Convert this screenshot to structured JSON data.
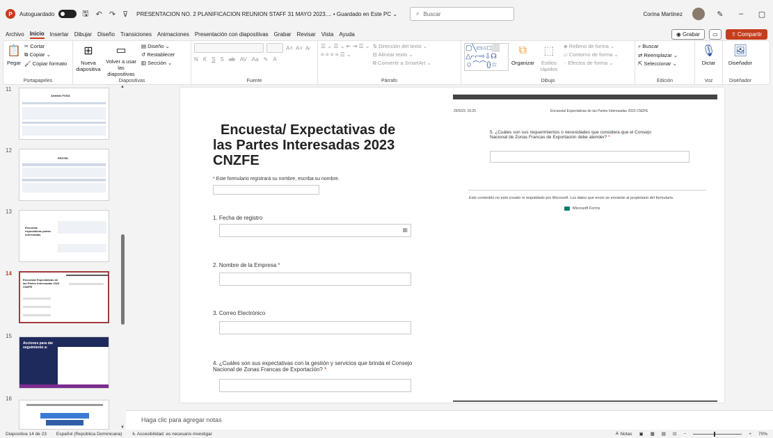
{
  "titlebar": {
    "autosave_label": "Autoguardado",
    "doc_title": "PRESENTACION NO. 2 PLANIFICACION REUNION STAFF 31 MAYO 2023....  •  Guardado en Este PC ⌄",
    "search_placeholder": "Buscar",
    "user_name": "Corina Martinez"
  },
  "menu": {
    "tabs": [
      "Archivo",
      "Inicio",
      "Insertar",
      "Dibujar",
      "Diseño",
      "Transiciones",
      "Animaciones",
      "Presentación con diapositivas",
      "Grabar",
      "Revisar",
      "Vista",
      "Ayuda"
    ],
    "grabar": "Grabar",
    "compartir": "Compartir"
  },
  "ribbon": {
    "portapapeles": {
      "pegar": "Pegar",
      "cortar": "Cortar",
      "copiar": "Copiar",
      "copiar_formato": "Copiar formato",
      "label": "Portapapeles"
    },
    "diapositivas": {
      "nueva": "Nueva diapositiva",
      "volver": "Volver a usar las diapositivas",
      "diseno": "Diseño",
      "restablecer": "Restablecer",
      "seccion": "Sección",
      "label": "Diapositivas"
    },
    "fuente": {
      "label": "Fuente"
    },
    "parrafo": {
      "direccion": "Dirección del texto",
      "alinear": "Alinear texto",
      "convertir": "Convertir a SmartArt",
      "label": "Párrafo"
    },
    "dibujo": {
      "organizar": "Organizar",
      "estilos": "Estilos rápidos",
      "relleno": "Relleno de forma",
      "contorno": "Contorno de forma",
      "efectos": "Efectos de forma",
      "label": "Dibujo"
    },
    "edicion": {
      "buscar": "Buscar",
      "reemplazar": "Reemplazar",
      "seleccionar": "Seleccionar",
      "label": "Edición"
    },
    "voz": {
      "dictar": "Dictar",
      "label": "Voz"
    },
    "disenador": {
      "btn": "Diseñador",
      "label": "Diseñador"
    }
  },
  "thumbnails": {
    "numbers": [
      "11",
      "12",
      "13",
      "14",
      "15",
      "16"
    ],
    "t11_title": "Análisis FODA",
    "t12_title": "PESTEL",
    "t13_title": "Encuesta expectativas partes interesadas",
    "t14_title": "Encuesta/ Expectativas de las Partes Interesadas 2023 CNZFE",
    "t15_title": "Acciones para dar seguimiento a:"
  },
  "slide": {
    "title_line1": "Encuesta/ Expectativas de",
    "title_line2": "las Partes Interesadas 2023",
    "title_line3": "CNZFE",
    "intro": "Este formulario registrará su nombre, escriba su nombre.",
    "q1": "1. Fecha de registro",
    "q2": "2. Nombre de la Empresa",
    "q3": "3. Correo Electrónico",
    "q4_line1": "4. ¿Cuáles son sus expectativas con la gestión y servicios que brinda el Consejo",
    "q4_line2": "Nacional de Zonas Francas de Exportación?",
    "hdr_date": "25/5/23, 15:25",
    "hdr_title": "Encuesta/ Expectativas de las Partes Interesadas 2023 CNZFE",
    "q5_line1": "5. ¿Cuáles son sus requerimientos o necesidades que considera que el Consejo",
    "q5_line2": "Nacional de Zonas Francas de Exportación debe atender?",
    "notice": "Este contenido no está creado ni respaldado por Microsoft. Los datos que envíe se enviarán al propietario del formulario.",
    "ms_forms": "Microsoft Forms",
    "required_mark": "*"
  },
  "notes_placeholder": "Haga clic para agregar notas",
  "status": {
    "slide_count": "Diapositiva 14 de 23",
    "language": "Español (República Dominicana)",
    "accessibility": "Accesibilidad: es necesario investigar",
    "notas": "Notas",
    "zoom": "70%"
  }
}
